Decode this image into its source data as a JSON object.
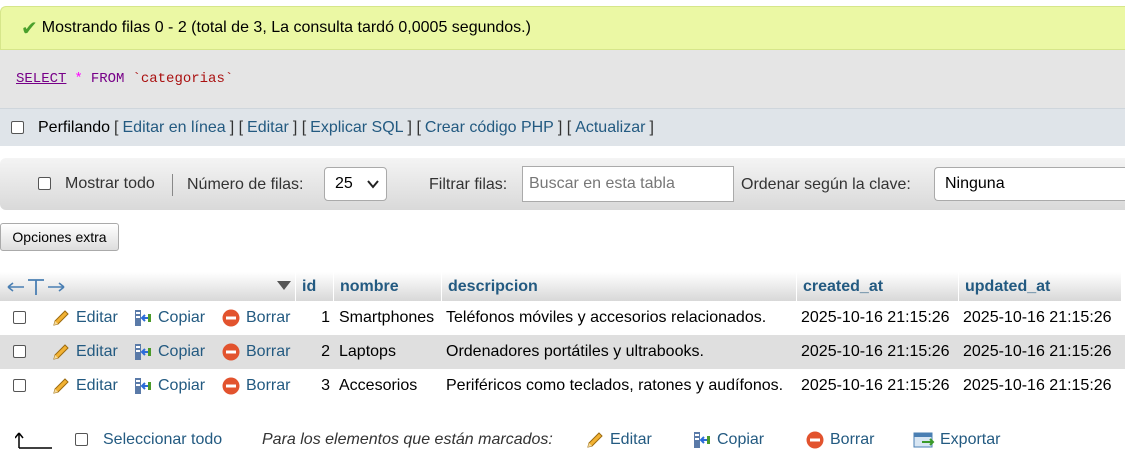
{
  "banner": {
    "message": "Mostrando filas 0 - 2 (total de 3, La consulta tardó 0,0005 segundos.)"
  },
  "sql": {
    "select": "SELECT",
    "star": "*",
    "from": "FROM",
    "table": "`categorias`"
  },
  "profiling": {
    "label": "Perfilando",
    "links": [
      "Editar en línea",
      "Editar",
      "Explicar SQL",
      "Crear código PHP",
      "Actualizar"
    ]
  },
  "nav": {
    "show_all": "Mostrar todo",
    "rows_label": "Número de filas:",
    "rows_value": "25",
    "filter_label": "Filtrar filas:",
    "filter_placeholder": "Buscar en esta tabla",
    "sort_label": "Ordenar según la clave:",
    "sort_value": "Ninguna"
  },
  "extra_options": "Opciones extra",
  "table": {
    "headers": [
      "id",
      "nombre",
      "descripcion",
      "created_at",
      "updated_at"
    ],
    "actions": {
      "edit": "Editar",
      "copy": "Copiar",
      "delete": "Borrar"
    },
    "rows": [
      {
        "id": "1",
        "nombre": "Smartphones",
        "descripcion": "Teléfonos móviles y accesorios relacionados.",
        "created_at": "2025-10-16 21:15:26",
        "updated_at": "2025-10-16 21:15:26"
      },
      {
        "id": "2",
        "nombre": "Laptops",
        "descripcion": "Ordenadores portátiles y ultrabooks.",
        "created_at": "2025-10-16 21:15:26",
        "updated_at": "2025-10-16 21:15:26"
      },
      {
        "id": "3",
        "nombre": "Accesorios",
        "descripcion": "Periféricos como teclados, ratones y audífonos.",
        "created_at": "2025-10-16 21:15:26",
        "updated_at": "2025-10-16 21:15:26"
      }
    ]
  },
  "footer": {
    "select_all": "Seleccionar todo",
    "with_selected": "Para los elementos que están marcados:",
    "edit": "Editar",
    "copy": "Copiar",
    "delete": "Borrar",
    "export": "Exportar"
  },
  "colors": {
    "banner_bg": "#ebf8a4",
    "link": "#235a81",
    "sql_keyword": "#770088",
    "delete_icon": "#e2532e"
  }
}
